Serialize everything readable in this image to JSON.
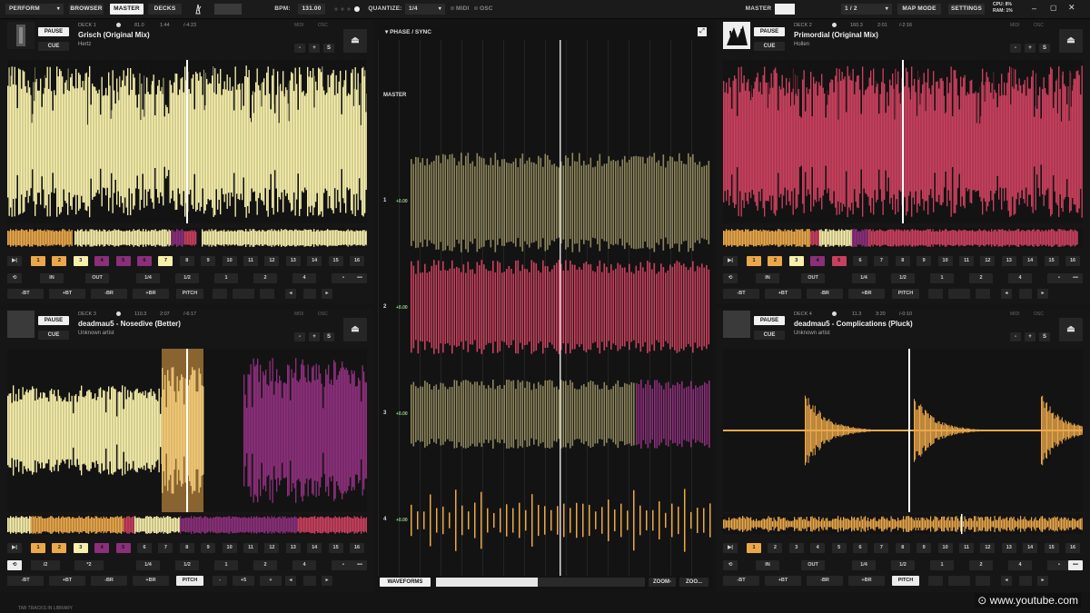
{
  "topbar": {
    "mode": "PERFORM",
    "browser": "BROWSER",
    "master": "MASTER",
    "decks": "DECKS",
    "bpm_label": "BPM:",
    "bpm_value": "131.00",
    "quantize_label": "QUANTIZE:",
    "quantize_value": "1/4",
    "midi": "MIDI",
    "osc": "OSC",
    "master_label": "MASTER",
    "layout_value": "1 / 2",
    "map_mode": "MAP MODE",
    "settings": "SETTINGS",
    "cpu": "CPU: 8%",
    "ram": "RAM: 1%"
  },
  "deck_common": {
    "pause": "PAUSE",
    "cue": "CUE",
    "minus": "-",
    "plus": "+",
    "s": "S",
    "midi": "MIDI",
    "osc": "OSC",
    "in": "IN",
    "out": "OUT",
    "minus_bt": "-BT",
    "plus_bt": "+BT",
    "minus_br": "-BR",
    "plus_br": "+BR",
    "pitch": "PITCH",
    "more": "•••",
    "loops": [
      "1/4",
      "1/2",
      "1",
      "2",
      "4",
      "•"
    ],
    "hotcues": [
      "1",
      "2",
      "3",
      "4",
      "5",
      "6",
      "7",
      "8",
      "9",
      "10",
      "11",
      "12",
      "13",
      "14",
      "15",
      "16"
    ]
  },
  "decks": [
    {
      "label": "DECK 1",
      "bpm": "81.0",
      "elapsed": "1:44",
      "remaining": "/-4:23",
      "title": "Grisch (Original Mix)",
      "artist": "Hertz"
    },
    {
      "label": "DECK 2",
      "bpm": "160.3",
      "elapsed": "2:01",
      "remaining": "/-2:16",
      "title": "Primordial (Original Mix)",
      "artist": "Hollen"
    },
    {
      "label": "DECK 3",
      "bpm": "110.3",
      "elapsed": "2:07",
      "remaining": "/-6:17",
      "title": "deadmau5 - Nosedive (Better)",
      "artist": "Unknown artist",
      "half": "/2",
      "double": "*2",
      "pitch_step": "+5"
    },
    {
      "label": "DECK 4",
      "bpm": "11.3",
      "elapsed": "3:20",
      "remaining": "/-0:10",
      "title": "deadmau5 - Complications (Pluck)",
      "artist": "Unknown artist"
    }
  ],
  "center": {
    "title": "PHASE / SYNC",
    "master": "MASTER",
    "channels": [
      {
        "num": "1",
        "offset": "+0.00"
      },
      {
        "num": "2",
        "offset": "+0.00"
      },
      {
        "num": "3",
        "offset": "+0.00"
      },
      {
        "num": "4",
        "offset": "+0.00"
      }
    ],
    "waveforms": "WAVEFORMS",
    "zoom_minus": "ZOOM-",
    "zoom_plus": "ZOO..."
  },
  "footer": "TAB TRACKS IN LIBRARY",
  "watermark": "www.youtube.com",
  "colors": {
    "cream": "#f7efaa",
    "pink": "#c9405e",
    "purple": "#8b2f7a",
    "orange": "#eba84a",
    "olive": "#8d855c"
  }
}
